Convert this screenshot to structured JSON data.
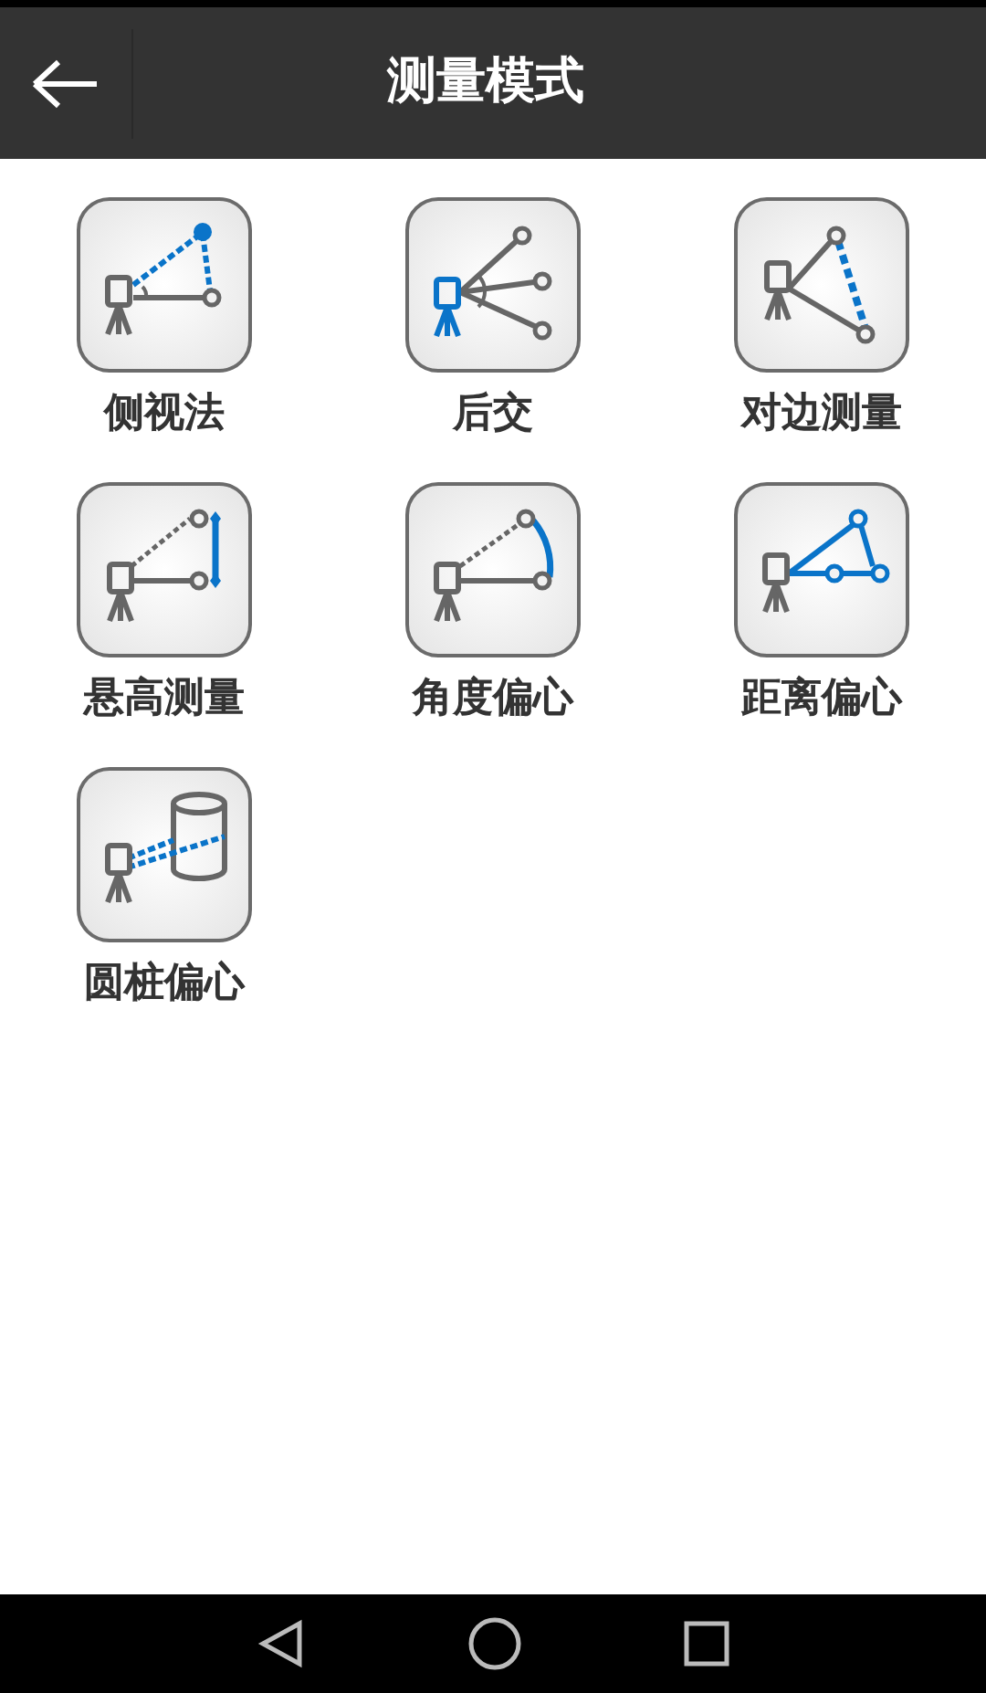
{
  "header": {
    "title": "测量模式"
  },
  "modes": [
    {
      "kind": "side_view",
      "label": "侧视法"
    },
    {
      "kind": "resection",
      "label": "后交"
    },
    {
      "kind": "tie_distance",
      "label": "对边测量"
    },
    {
      "kind": "remote_height",
      "label": "悬高测量"
    },
    {
      "kind": "angle_offset",
      "label": "角度偏心"
    },
    {
      "kind": "distance_offset",
      "label": "距离偏心"
    },
    {
      "kind": "cylinder_offset",
      "label": "圆桩偏心"
    }
  ]
}
